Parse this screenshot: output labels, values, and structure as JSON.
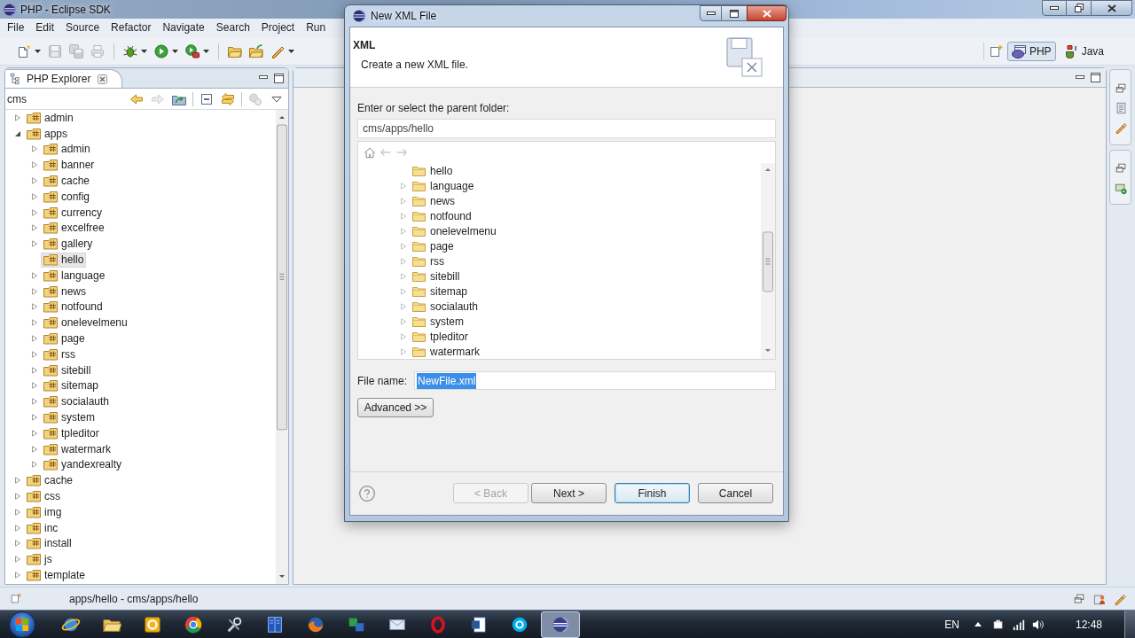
{
  "window": {
    "title": "PHP - Eclipse SDK"
  },
  "menu": [
    "File",
    "Edit",
    "Source",
    "Refactor",
    "Navigate",
    "Search",
    "Project",
    "Run"
  ],
  "toolbar": [
    [
      {
        "disabled": false,
        "dropdown": true
      },
      {
        "disabled": true,
        "dropdown": false
      },
      {
        "disabled": true,
        "dropdown": false
      },
      {
        "disabled": true,
        "dropdown": false
      }
    ],
    [
      {
        "disabled": false,
        "dropdown": true
      },
      {
        "disabled": false,
        "dropdown": true
      },
      {
        "disabled": false,
        "dropdown": true
      }
    ],
    [
      {
        "disabled": false,
        "dropdown": false
      },
      {
        "disabled": false,
        "dropdown": false
      },
      {
        "disabled": false,
        "dropdown": true
      }
    ]
  ],
  "perspectives": [
    {
      "label": "PHP",
      "selected": true
    },
    {
      "label": "Java",
      "selected": false
    }
  ],
  "explorer": {
    "tab": "PHP Explorer",
    "path": "cms",
    "toolbar": [
      [
        {
          "disabled": false
        },
        {
          "disabled": true
        },
        {
          "disabled": false
        }
      ],
      [
        {
          "disabled": false
        },
        {
          "disabled": false
        }
      ],
      [
        {
          "disabled": true
        },
        {
          "disabled": false
        }
      ]
    ],
    "tree": [
      {
        "label": "admin",
        "expandable": true,
        "expanded": false,
        "selected": false
      },
      {
        "label": "apps",
        "expandable": true,
        "expanded": true,
        "selected": false,
        "children": [
          {
            "label": "admin",
            "expandable": true,
            "expanded": false,
            "selected": false
          },
          {
            "label": "banner",
            "expandable": true,
            "expanded": false,
            "selected": false
          },
          {
            "label": "cache",
            "expandable": true,
            "expanded": false,
            "selected": false
          },
          {
            "label": "config",
            "expandable": true,
            "expanded": false,
            "selected": false
          },
          {
            "label": "currency",
            "expandable": true,
            "expanded": false,
            "selected": false
          },
          {
            "label": "excelfree",
            "expandable": true,
            "expanded": false,
            "selected": false
          },
          {
            "label": "gallery",
            "expandable": true,
            "expanded": false,
            "selected": false
          },
          {
            "label": "hello",
            "expandable": false,
            "selected": true
          },
          {
            "label": "language",
            "expandable": true,
            "expanded": false,
            "selected": false
          },
          {
            "label": "news",
            "expandable": true,
            "expanded": false,
            "selected": false
          },
          {
            "label": "notfound",
            "expandable": true,
            "expanded": false,
            "selected": false
          },
          {
            "label": "onelevelmenu",
            "expandable": true,
            "expanded": false,
            "selected": false
          },
          {
            "label": "page",
            "expandable": true,
            "expanded": false,
            "selected": false
          },
          {
            "label": "rss",
            "expandable": true,
            "expanded": false,
            "selected": false
          },
          {
            "label": "sitebill",
            "expandable": true,
            "expanded": false,
            "selected": false
          },
          {
            "label": "sitemap",
            "expandable": true,
            "expanded": false,
            "selected": false
          },
          {
            "label": "socialauth",
            "expandable": true,
            "expanded": false,
            "selected": false
          },
          {
            "label": "system",
            "expandable": true,
            "expanded": false,
            "selected": false
          },
          {
            "label": "tpleditor",
            "expandable": true,
            "expanded": false,
            "selected": false
          },
          {
            "label": "watermark",
            "expandable": true,
            "expanded": false,
            "selected": false
          },
          {
            "label": "yandexrealty",
            "expandable": true,
            "expanded": false,
            "selected": false
          }
        ]
      },
      {
        "label": "cache",
        "expandable": true,
        "expanded": false,
        "selected": false
      },
      {
        "label": "css",
        "expandable": true,
        "expanded": false,
        "selected": false
      },
      {
        "label": "img",
        "expandable": true,
        "expanded": false,
        "selected": false
      },
      {
        "label": "inc",
        "expandable": true,
        "expanded": false,
        "selected": false
      },
      {
        "label": "install",
        "expandable": true,
        "expanded": false,
        "selected": false
      },
      {
        "label": "js",
        "expandable": true,
        "expanded": false,
        "selected": false
      },
      {
        "label": "template",
        "expandable": true,
        "expanded": false,
        "selected": false
      }
    ]
  },
  "status_bar": {
    "text": "apps/hello - cms/apps/hello"
  },
  "taskbar": {
    "apps": [
      {
        "selected": false
      },
      {
        "selected": false
      },
      {
        "selected": false
      },
      {
        "selected": false
      },
      {
        "selected": false
      },
      {
        "selected": false
      },
      {
        "selected": false
      },
      {
        "selected": false
      },
      {
        "selected": false
      },
      {
        "selected": false
      },
      {
        "selected": false
      },
      {
        "selected": false
      },
      {
        "selected": true
      }
    ],
    "language": "EN",
    "clock": "12:48"
  },
  "dialog": {
    "title": "New XML File",
    "heading": "XML",
    "description": "Create a new XML file.",
    "folder_label": "Enter or select the parent folder:",
    "folder_value": "cms/apps/hello",
    "tree_toolbar": [
      {
        "disabled": false
      },
      {
        "disabled": true
      },
      {
        "disabled": true
      }
    ],
    "folders": [
      {
        "label": "hello",
        "expandable": false
      },
      {
        "label": "language",
        "expandable": true
      },
      {
        "label": "news",
        "expandable": true
      },
      {
        "label": "notfound",
        "expandable": true
      },
      {
        "label": "onelevelmenu",
        "expandable": true
      },
      {
        "label": "page",
        "expandable": true
      },
      {
        "label": "rss",
        "expandable": true
      },
      {
        "label": "sitebill",
        "expandable": true
      },
      {
        "label": "sitemap",
        "expandable": true
      },
      {
        "label": "socialauth",
        "expandable": true
      },
      {
        "label": "system",
        "expandable": true
      },
      {
        "label": "tpleditor",
        "expandable": true
      },
      {
        "label": "watermark",
        "expandable": true
      }
    ],
    "file_name_label": "File name:",
    "file_name": {
      "value": "NewFile.xml",
      "selected": true
    },
    "advanced_button": "Advanced >>",
    "buttons": [
      {
        "label": "< Back",
        "disabled": true,
        "default": false
      },
      {
        "label": "Next >",
        "disabled": false,
        "default": false
      },
      {
        "label": "Finish",
        "disabled": false,
        "default": true
      },
      {
        "label": "Cancel",
        "disabled": false,
        "default": false
      }
    ]
  }
}
